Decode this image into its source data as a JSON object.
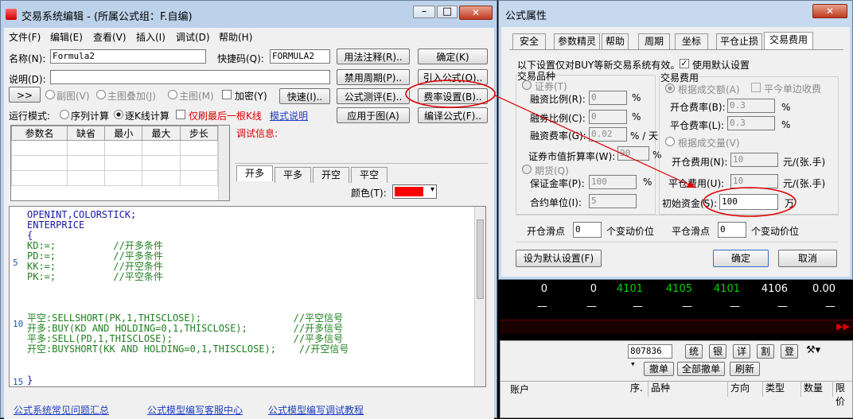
{
  "editor": {
    "title": "交易系统编辑 - (所属公式组：F.自编)",
    "menu": [
      "文件(F)",
      "编辑(E)",
      "查看(V)",
      "插入(I)",
      "调试(D)",
      "帮助(H)"
    ],
    "name_label": "名称(N):",
    "name_value": "Formula2",
    "shortcut_label": "快捷码(Q):",
    "shortcut_value": "FORMULA2",
    "desc_label": "说明(D):",
    "btn_usage": "用法注释(R)..",
    "btn_ok": "确定(K)",
    "btn_disable_period": "禁用周期(P)..",
    "btn_import": "引入公式(O)..",
    "btn_arrow": ">>",
    "radio_sub": "副图(V)",
    "radio_main_overlay": "主图叠加(J)",
    "radio_main": "主图(M)",
    "chk_encrypt": "加密(Y)",
    "btn_quick": "快速(I)..",
    "btn_test": "公式测评(E)..",
    "btn_fee": "费率设置(B)..",
    "run_mode_label": "运行模式:",
    "radio_seq": "序列计算",
    "radio_kline": "逐K线计算",
    "chk_last_only": "仅刷最后一根K线",
    "mode_link": "模式说明",
    "btn_apply": "应用于图(A)",
    "btn_compile": "编译公式(F)..",
    "param_headers": [
      "参数名",
      "缺省",
      "最小",
      "最大",
      "步长"
    ],
    "debug_label": "调试信息:",
    "tabs": [
      "开多",
      "平多",
      "开空",
      "平空"
    ],
    "color_label": "颜色(T):",
    "color_value": "#ff0000",
    "line_numbers": [
      "5",
      "10",
      "15"
    ],
    "code_lines": [
      "OPENINT,COLORSTICK;",
      "ENTERPRICE",
      "{",
      "KD:=;          //开多条件",
      "PD:=;          //平多条件",
      "KK:=;          //开空条件",
      "PK:=;          //平空条件",
      "",
      "",
      "平空:SELLSHORT(PK,1,THISCLOSE);                //平空信号",
      "开多:BUY(KD AND HOLDING=0,1,THISCLOSE);        //开多信号",
      "平多:SELL(PD,1,THISCLOSE);                     //平多信号",
      "开空:BUYSHORT(KK AND HOLDING=0,1,THISCLOSE);    //开空信号",
      "",
      "}"
    ],
    "footer_links": [
      "公式系统常见问题汇总",
      "公式模型编写客服中心",
      "公式模型编写调试教程"
    ]
  },
  "dialog": {
    "title": "公式属性",
    "tabs": [
      "安全",
      "参数精灵",
      "帮助",
      "周期",
      "坐标",
      "平仓止损",
      "交易费用"
    ],
    "note": "以下设置仅对BUY等新交易系统有效。",
    "use_default_label": "使用默认设置",
    "variety_label": "交易品种",
    "securities_label": "证券(T)",
    "margin_financing_label": "融资比例(R):",
    "margin_financing_value": "0",
    "pct1": "%",
    "margin_lending_label": "融券比例(C):",
    "margin_lending_value": "0",
    "pct2": "%",
    "financing_fee_label": "融资费率(G):",
    "financing_fee_value": "0.02",
    "fee_unit": "% / 天",
    "market_value_label": "证券市值折算率(W):",
    "market_value_value": "90",
    "pct3": "%",
    "futures_label": "期货(Q)",
    "deposit_label": "保证金率(P):",
    "deposit_value": "100",
    "pct4": "%",
    "contract_unit_label": "合约单位(I):",
    "contract_unit_value": "5",
    "fee_group_label": "交易费用",
    "by_amount_label": "根据成交额(A)",
    "close_unilateral_label": "平今单边收费",
    "open_rate_label": "开仓费率(B):",
    "open_rate_value": "0.3",
    "pct5": "%",
    "close_rate_label": "平仓费率(L):",
    "close_rate_value": "0.3",
    "pct6": "%",
    "by_volume_label": "根据成交量(V)",
    "open_fee_label": "开仓费用(N):",
    "open_fee_value": "10",
    "open_fee_unit": "元/(张.手)",
    "close_fee_label": "平仓费用(U):",
    "close_fee_value": "10",
    "close_fee_unit": "元/(张.手)",
    "initial_capital_label": "初始资金(S):",
    "initial_capital_value": "100",
    "capital_unit": "万",
    "open_slip_label": "开仓滑点",
    "open_slip_value": "0",
    "open_slip_unit": "个变动价位",
    "close_slip_label": "平仓滑点",
    "close_slip_value": "0",
    "close_slip_unit": "个变动价位",
    "btn_default": "设为默认设置(F)",
    "btn_ok": "确定",
    "btn_cancel": "取消"
  },
  "background": {
    "quote_row": [
      "0",
      "0",
      "4101",
      "4105",
      "4101",
      "4106",
      "0.00"
    ],
    "quote_row2": [
      "—",
      "—",
      "—",
      "—",
      "—",
      "—",
      "—"
    ],
    "account_id": "807836",
    "trade_buttons": [
      "统",
      "银",
      "详",
      "割",
      "登"
    ],
    "btn_cancel_order": "撤单",
    "btn_cancel_all": "全部撤单",
    "btn_refresh": "刷新",
    "account_header": "账户",
    "order_headers": [
      "序.",
      "品种",
      "方向",
      "类型",
      "数量",
      "限价"
    ]
  },
  "colors": {
    "accent_red": "#e00000",
    "link_blue": "#1f3fbf",
    "comment_green": "#208020",
    "keyword_blue": "#1818a8",
    "quote_green": "#00d000"
  }
}
